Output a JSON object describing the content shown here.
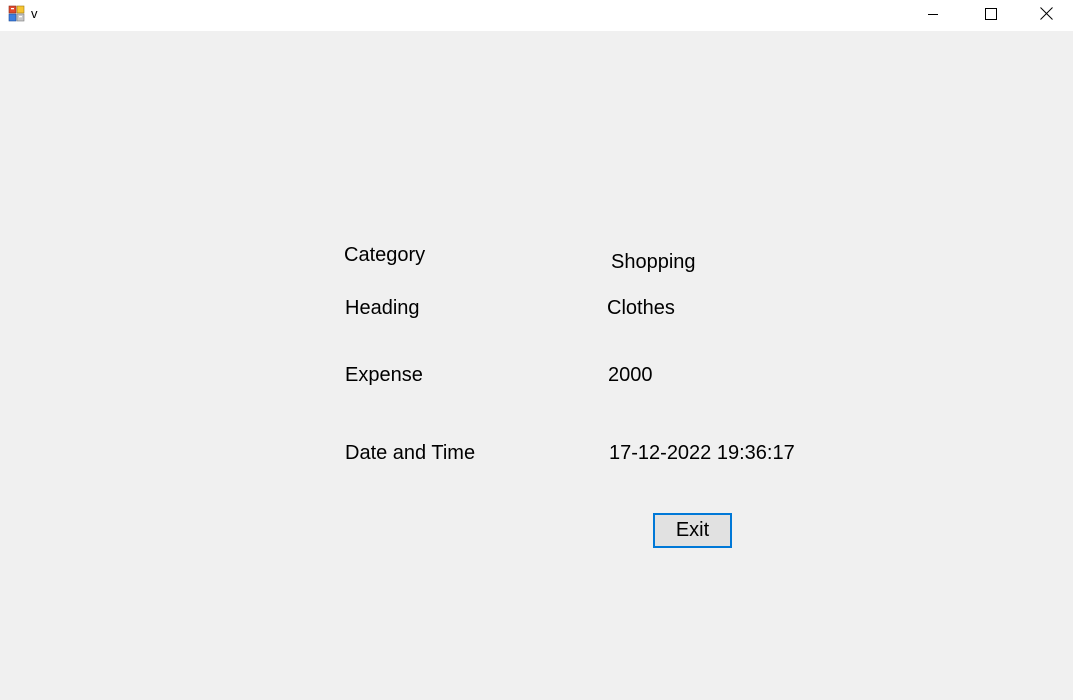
{
  "window": {
    "title": "v",
    "app_icon": "winforms-app-icon",
    "controls": {
      "minimize_icon": "minimize-icon",
      "maximize_icon": "maximize-icon",
      "close_icon": "close-icon"
    }
  },
  "form": {
    "category_label": "Category",
    "category_value": "Shopping",
    "heading_label": "Heading",
    "heading_value": "Clothes",
    "expense_label": "Expense",
    "expense_value": "2000",
    "datetime_label": "Date and Time",
    "datetime_value": "17-12-2022 19:36:17",
    "exit_label": "Exit"
  },
  "colors": {
    "background": "#f0f0f0",
    "titlebar": "#ffffff",
    "button_focus_border": "#0078d7",
    "button_face": "#e1e1e1"
  }
}
